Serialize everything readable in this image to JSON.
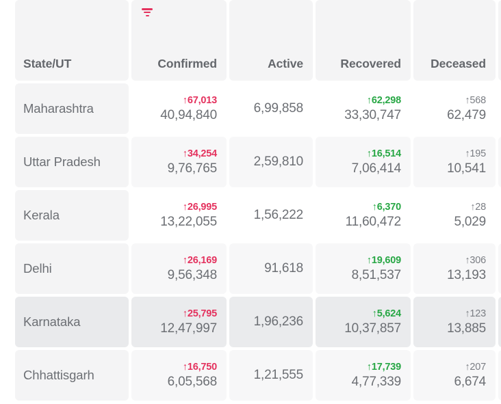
{
  "table": {
    "sort_icon": "sort-descending-icon",
    "columns": [
      {
        "key": "state",
        "label": "State/UT",
        "align": "left",
        "sorted": false
      },
      {
        "key": "confirmed",
        "label": "Confirmed",
        "align": "right",
        "sorted": true
      },
      {
        "key": "active",
        "label": "Active",
        "align": "right",
        "sorted": false
      },
      {
        "key": "recovered",
        "label": "Recovered",
        "align": "right",
        "sorted": false
      },
      {
        "key": "deceased",
        "label": "Deceased",
        "align": "right",
        "sorted": false
      }
    ],
    "colors": {
      "confirmed_delta": "#e4325e",
      "recovered_delta": "#28a745",
      "deceased_delta": "#7b7e84",
      "text": "#6c6f74",
      "header_bg": "#f4f4f5",
      "row_alt_bg": "#f7f7f8",
      "row_hover_bg": "#eaebed"
    },
    "delta_arrow": "↑",
    "rows": [
      {
        "state": "Maharashtra",
        "confirmed_delta": "↑67,013",
        "confirmed_total": "40,94,840",
        "active_total": "6,99,858",
        "recovered_delta": "↑62,298",
        "recovered_total": "33,30,747",
        "deceased_delta": "↑568",
        "deceased_total": "62,479",
        "highlight": false
      },
      {
        "state": "Uttar Pradesh",
        "confirmed_delta": "↑34,254",
        "confirmed_total": "9,76,765",
        "active_total": "2,59,810",
        "recovered_delta": "↑16,514",
        "recovered_total": "7,06,414",
        "deceased_delta": "↑195",
        "deceased_total": "10,541",
        "highlight": false
      },
      {
        "state": "Kerala",
        "confirmed_delta": "↑26,995",
        "confirmed_total": "13,22,055",
        "active_total": "1,56,222",
        "recovered_delta": "↑6,370",
        "recovered_total": "11,60,472",
        "deceased_delta": "↑28",
        "deceased_total": "5,029",
        "highlight": false
      },
      {
        "state": "Delhi",
        "confirmed_delta": "↑26,169",
        "confirmed_total": "9,56,348",
        "active_total": "91,618",
        "recovered_delta": "↑19,609",
        "recovered_total": "8,51,537",
        "deceased_delta": "↑306",
        "deceased_total": "13,193",
        "highlight": false
      },
      {
        "state": "Karnataka",
        "confirmed_delta": "↑25,795",
        "confirmed_total": "12,47,997",
        "active_total": "1,96,236",
        "recovered_delta": "↑5,624",
        "recovered_total": "10,37,857",
        "deceased_delta": "↑123",
        "deceased_total": "13,885",
        "highlight": true
      },
      {
        "state": "Chhattisgarh",
        "confirmed_delta": "↑16,750",
        "confirmed_total": "6,05,568",
        "active_total": "1,21,555",
        "recovered_delta": "↑17,739",
        "recovered_total": "4,77,339",
        "deceased_delta": "↑207",
        "deceased_total": "6,674",
        "highlight": false
      }
    ]
  }
}
